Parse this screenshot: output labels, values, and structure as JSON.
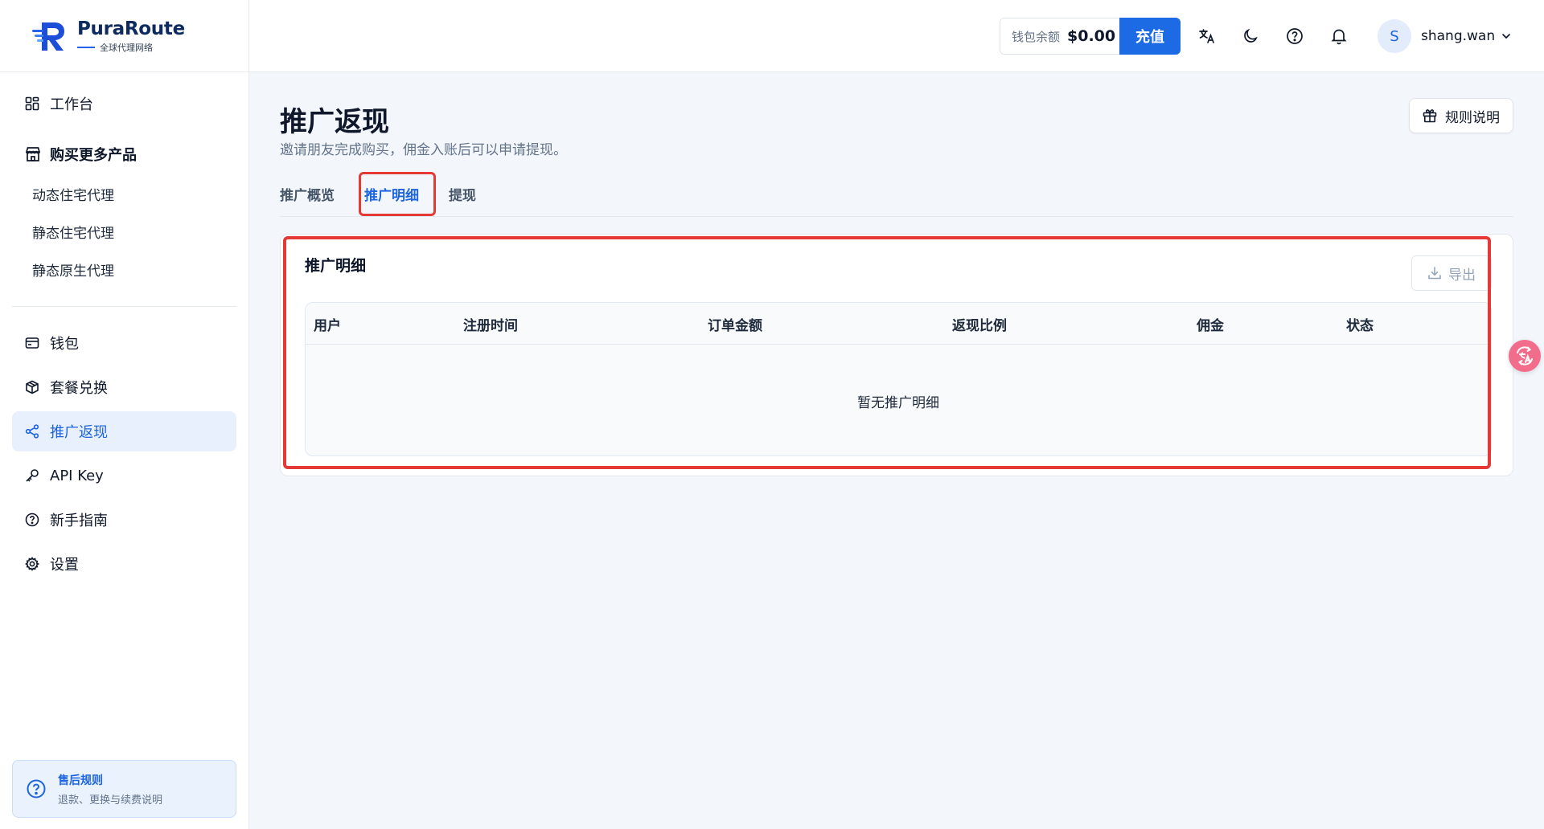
{
  "brand": {
    "name": "PuraRoute",
    "tagline": "全球代理网络"
  },
  "sidebar": {
    "dashboard": "工作台",
    "buy_group": "购买更多产品",
    "products": [
      "动态住宅代理",
      "静态住宅代理",
      "静态原生代理"
    ],
    "wallet": "钱包",
    "package_redeem": "套餐兑换",
    "referral": "推广返现",
    "api_key": "API Key",
    "guide": "新手指南",
    "settings": "设置",
    "after_sales": {
      "title": "售后规则",
      "subtitle": "退款、更换与续费说明"
    }
  },
  "header": {
    "wallet_label": "钱包余额",
    "wallet_amount": "$0.00",
    "recharge": "充值",
    "avatar_initial": "S",
    "username": "shang.wan"
  },
  "page": {
    "title": "推广返现",
    "description": "邀请朋友完成购买，佣金入账后可以申请提现。",
    "rules_button": "规则说明",
    "tabs": [
      "推广概览",
      "推广明细",
      "提现"
    ],
    "active_tab": "推广明细"
  },
  "details_card": {
    "title": "推广明细",
    "export": "导出",
    "columns": [
      "用户",
      "注册时间",
      "订单金额",
      "返现比例",
      "佣金",
      "状态"
    ],
    "empty_text": "暂无推广明细"
  },
  "colors": {
    "accent": "#1d6ae5",
    "highlight": "#e53935",
    "translate_float": "#f26d8b"
  }
}
